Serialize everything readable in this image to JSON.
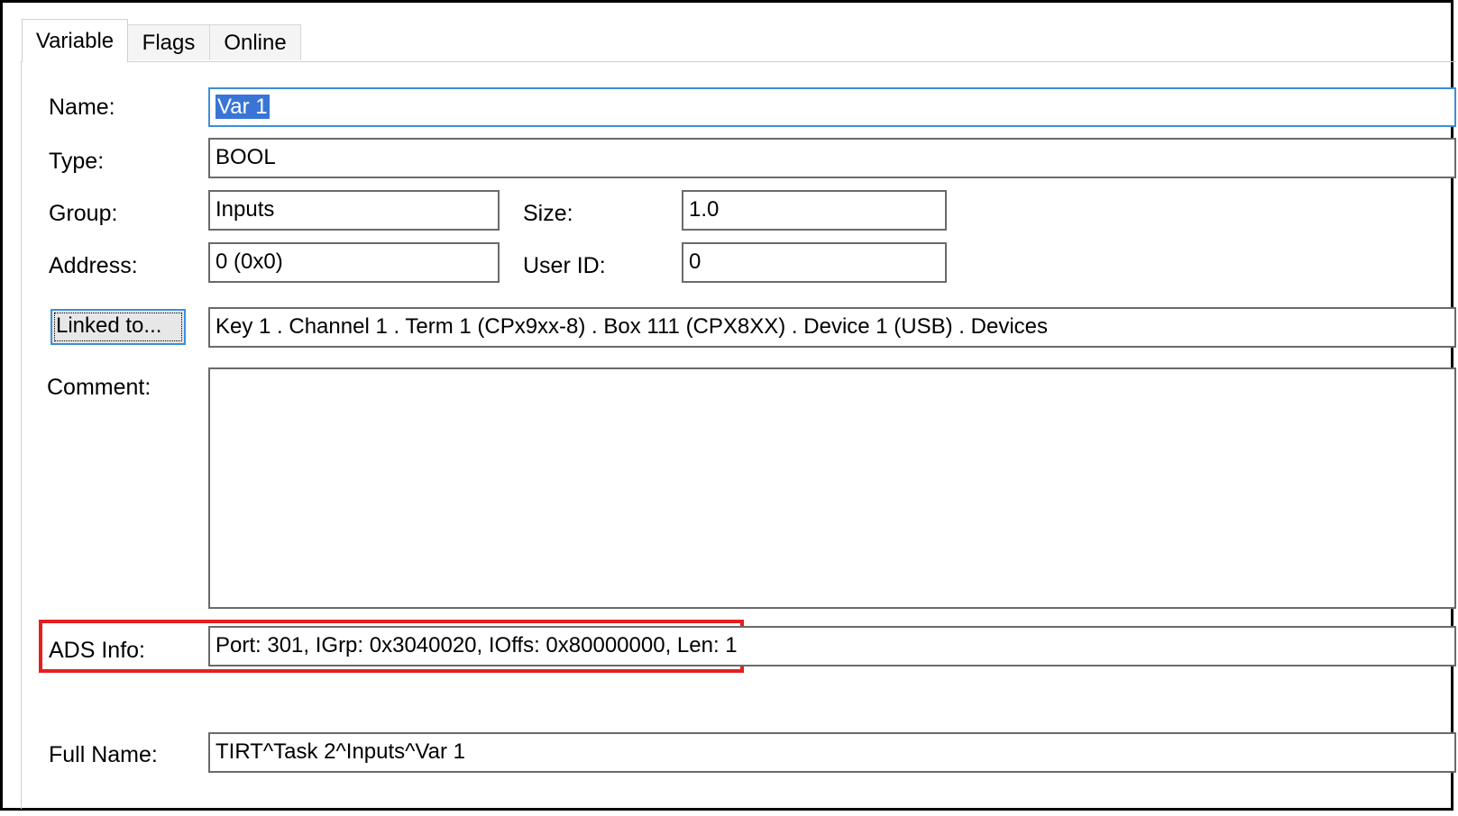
{
  "tabs": [
    {
      "label": "Variable",
      "active": true
    },
    {
      "label": "Flags",
      "active": false
    },
    {
      "label": "Online",
      "active": false
    }
  ],
  "form": {
    "name_label": "Name:",
    "name_value": "Var 1",
    "type_label": "Type:",
    "type_value": "BOOL",
    "group_label": "Group:",
    "group_value": "Inputs",
    "size_label": "Size:",
    "size_value": "1.0",
    "address_label": "Address:",
    "address_value": "0 (0x0)",
    "userid_label": "User ID:",
    "userid_value": "0",
    "linked_button": "Linked to...",
    "linked_value": "Key 1 . Channel 1 . Term 1 (CPx9xx-8) . Box 111 (CPX8XX) . Device 1 (USB) . Devices",
    "comment_label": "Comment:",
    "comment_value": "",
    "ads_label": "ADS Info:",
    "ads_value": "Port: 301, IGrp: 0x3040020, IOffs: 0x80000000, Len: 1",
    "fullname_label": "Full Name:",
    "fullname_value": "TIRT^Task 2^Inputs^Var 1"
  },
  "colors": {
    "highlight_box": "#e41f1f",
    "focus_border": "#3c8edb",
    "selection": "#3875d7"
  }
}
